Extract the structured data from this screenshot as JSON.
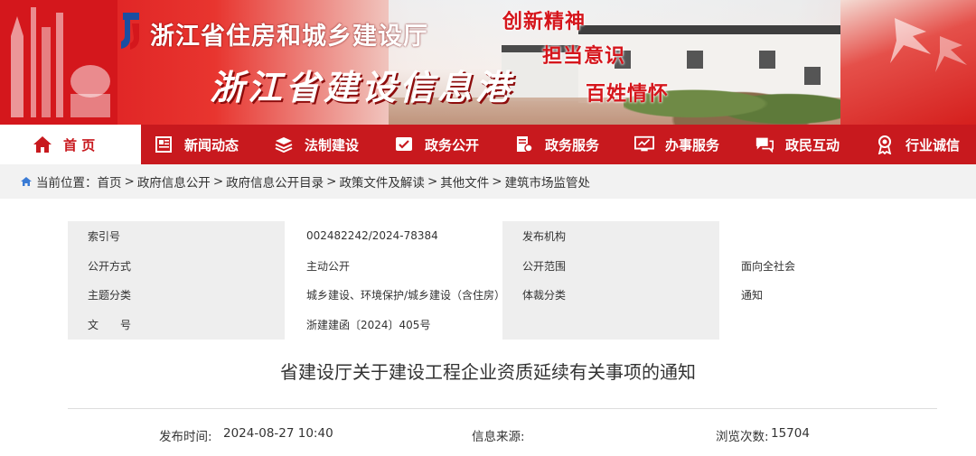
{
  "header": {
    "org_name": "浙江省住房和城乡建设厅",
    "site_name": "浙江省建设信息港",
    "slogans": [
      "创新精神",
      "担当意识",
      "百姓情怀"
    ]
  },
  "nav": {
    "items": [
      {
        "label": "首 页",
        "icon": "home-icon"
      },
      {
        "label": "新闻动态",
        "icon": "newspaper-icon"
      },
      {
        "label": "法制建设",
        "icon": "layers-icon"
      },
      {
        "label": "政务公开",
        "icon": "announcement-icon"
      },
      {
        "label": "政务服务",
        "icon": "document-service-icon"
      },
      {
        "label": "办事服务",
        "icon": "monitor-icon"
      },
      {
        "label": "政民互动",
        "icon": "chat-icon"
      },
      {
        "label": "行业诚信",
        "icon": "medal-icon"
      }
    ],
    "active_color": "#c8191e"
  },
  "breadcrumb": {
    "prefix": "当前位置：",
    "items": [
      "首页",
      "政府信息公开",
      "政府信息公开目录",
      "政策文件及解读",
      "其他文件",
      "建筑市场监管处"
    ],
    "separator": ">"
  },
  "meta": {
    "rows": [
      [
        "索引号",
        "002482242/2024-78384",
        "发布机构",
        ""
      ],
      [
        "公开方式",
        "主动公开",
        "公开范围",
        "面向全社会"
      ],
      [
        "主题分类",
        "城乡建设、环境保护/城乡建设（含住房）",
        "体裁分类",
        "通知"
      ],
      [
        "文　　号",
        "浙建建函〔2024〕405号",
        "",
        ""
      ]
    ]
  },
  "article": {
    "title": "省建设厅关于建设工程企业资质延续有关事项的通知",
    "publish_label": "发布时间:",
    "publish_time": "2024-08-27 10:40",
    "source_label": "信息来源:",
    "source": "",
    "views_label": "浏览次数:",
    "views": "15704"
  }
}
